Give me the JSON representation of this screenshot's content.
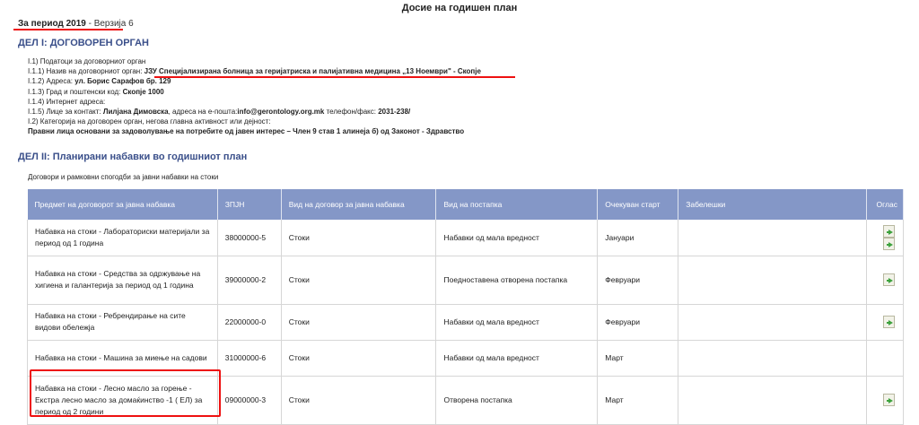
{
  "header": {
    "title": "Досие на годишен план"
  },
  "period": {
    "label": "За период 2019",
    "version": "- Верзија 6"
  },
  "section1": {
    "title": "ДЕЛ I: ДОГОВОРЕН ОРГАН"
  },
  "info": {
    "l1": "I.1) Податоци за договорниот орган",
    "l2_label": "I.1.1) Назив на договорниот орган:",
    "l2_value": "ЈЗУ Специјализирана болница за геријатриска и палијативна медицина „13 Ноември\" - Скопје",
    "l3_label": "I.1.2) Адреса:",
    "l3_value": "ул. Борис Сарафов бр. 129",
    "l4_label": "I.1.3) Град и поштенски код:",
    "l4_value": "Скопје 1000",
    "l5": "I.1.4) Интернет адреса:",
    "l6_label": "I.1.5) Лице за контакт:",
    "l6_name": "Лилјана Димовска",
    "l6_mid": ", адреса на е-пошта:",
    "l6_email": "info@gerontology.org.mk",
    "l6_tel_label": " телефон/факс: ",
    "l6_tel": "2031-238/",
    "l7": "I.2) Категорија на договорен орган, негова главна активност или дејност:",
    "l8": "Правни лица основани за задоволување на потребите од јавен интерес – Член 9 став 1 алинеја б) од Законот - Здравство"
  },
  "section2": {
    "title": "ДЕЛ II: Планирани набавки во годишниот план",
    "subnote": "Договори и рамковни спогодби за јавни набавки на стоки"
  },
  "table": {
    "headers": [
      "Предмет на договорот за јавна набавка",
      "ЗПЈН",
      "Вид на договор за јавна набавка",
      "Вид на постапка",
      "Очекуван старт",
      "Забелешки",
      "Оглас"
    ],
    "rows": [
      {
        "subject": "Набавка на стоки - Лабораториски материјали за период од 1 година",
        "code": "38000000-5",
        "type": "Стоки",
        "procedure": "Набавки од мала вредност",
        "start": "Јануари",
        "notes": ""
      },
      {
        "subject": "Набавка на стоки - Средства за одржување на хигиена и галантерија за период од 1 година",
        "code": "39000000-2",
        "type": "Стоки",
        "procedure": "Поедноставена отворена постапка",
        "start": "Февруари",
        "notes": ""
      },
      {
        "subject": "Набавка на стоки - Ребрендирање на сите видови обележја",
        "code": "22000000-0",
        "type": "Стоки",
        "procedure": "Набавки од мала вредност",
        "start": "Февруари",
        "notes": ""
      },
      {
        "subject": "Набавка на стоки - Машина за миење на садови",
        "code": "31000000-6",
        "type": "Стоки",
        "procedure": "Набавки од мала вредност",
        "start": "Март",
        "notes": ""
      },
      {
        "subject": "Набавка на стоки - Лесно масло за горење - Екстра лесно масло за домаќинство -1 ( ЕЛ) за период од 2 години",
        "code": "09000000-3",
        "type": "Стоки",
        "procedure": "Отворена постапка",
        "start": "Март",
        "notes": ""
      }
    ]
  },
  "colors": {
    "header_bg": "#8497c7",
    "section": "#3a4f8a",
    "highlight": "#ee1111"
  },
  "icons": [
    "document-arrow-icon"
  ]
}
